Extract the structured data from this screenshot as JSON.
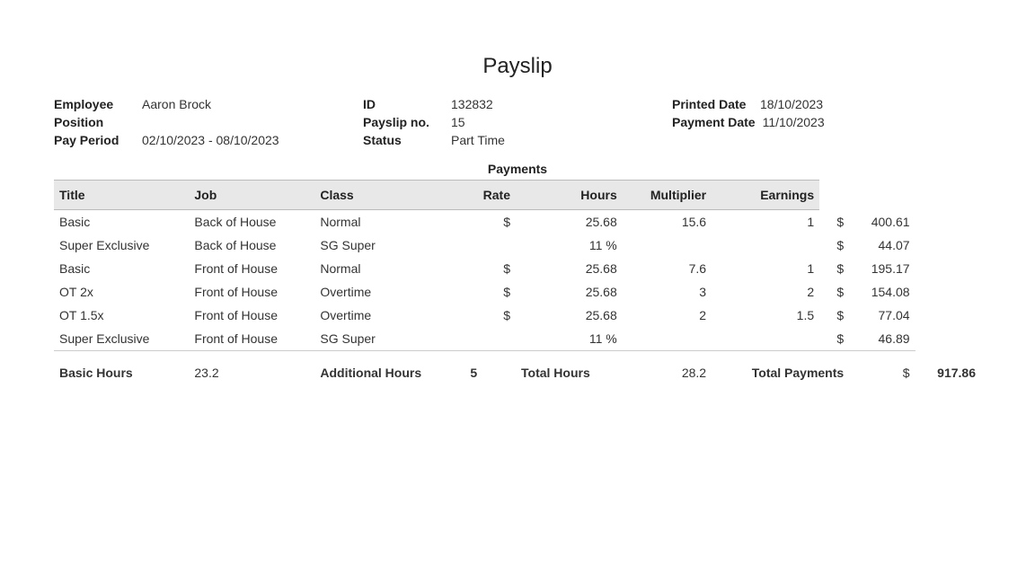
{
  "title": "Payslip",
  "header": {
    "employee_label": "Employee",
    "employee_value": "Aaron Brock",
    "position_label": "Position",
    "position_value": "",
    "pay_period_label": "Pay Period",
    "pay_period_value": "02/10/2023 - 08/10/2023",
    "id_label": "ID",
    "id_value": "132832",
    "payslip_no_label": "Payslip no.",
    "payslip_no_value": "15",
    "status_label": "Status",
    "status_value": "Part Time",
    "printed_date_label": "Printed Date",
    "printed_date_value": "18/10/2023",
    "payment_date_label": "Payment Date",
    "payment_date_value": "11/10/2023"
  },
  "payments": {
    "heading": "Payments",
    "columns": {
      "title": "Title",
      "job": "Job",
      "class": "Class",
      "rate": "Rate",
      "hours": "Hours",
      "multiplier": "Multiplier",
      "earnings": "Earnings"
    },
    "rows": [
      {
        "title": "Basic",
        "job": "Back of House",
        "class": "Normal",
        "rate_symbol": "$",
        "rate": "25.68",
        "hours": "15.6",
        "multiplier": "1",
        "earnings_symbol": "$",
        "earnings": "400.61"
      },
      {
        "title": "Super Exclusive",
        "job": "Back of House",
        "class": "SG Super",
        "rate_symbol": "",
        "rate": "11 %",
        "hours": "",
        "multiplier": "",
        "earnings_symbol": "$",
        "earnings": "44.07"
      },
      {
        "title": "Basic",
        "job": "Front of House",
        "class": "Normal",
        "rate_symbol": "$",
        "rate": "25.68",
        "hours": "7.6",
        "multiplier": "1",
        "earnings_symbol": "$",
        "earnings": "195.17"
      },
      {
        "title": "OT 2x",
        "job": "Front of House",
        "class": "Overtime",
        "rate_symbol": "$",
        "rate": "25.68",
        "hours": "3",
        "multiplier": "2",
        "earnings_symbol": "$",
        "earnings": "154.08"
      },
      {
        "title": "OT 1.5x",
        "job": "Front of House",
        "class": "Overtime",
        "rate_symbol": "$",
        "rate": "25.68",
        "hours": "2",
        "multiplier": "1.5",
        "earnings_symbol": "$",
        "earnings": "77.04"
      },
      {
        "title": "Super Exclusive",
        "job": "Front of House",
        "class": "SG Super",
        "rate_symbol": "",
        "rate": "11 %",
        "hours": "",
        "multiplier": "",
        "earnings_symbol": "$",
        "earnings": "46.89"
      }
    ],
    "totals": {
      "basic_hours_label": "Basic Hours",
      "basic_hours_value": "23.2",
      "additional_hours_label": "Additional Hours",
      "additional_hours_value": "5",
      "total_hours_label": "Total Hours",
      "total_hours_value": "28.2",
      "total_payments_label": "Total Payments",
      "total_payments_symbol": "$",
      "total_payments_value": "917.86"
    }
  }
}
